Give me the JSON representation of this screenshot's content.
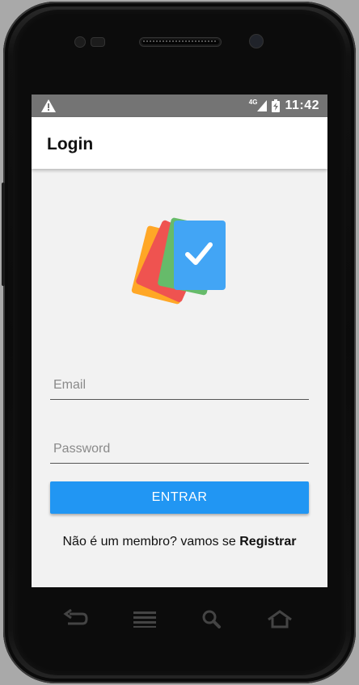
{
  "status_bar": {
    "warning_icon": "warning-triangle-icon",
    "network": "4G",
    "battery_icon": "battery-charging-icon",
    "time": "11:42"
  },
  "app_bar": {
    "title": "Login"
  },
  "logo": {
    "icon": "stacked-cards-check-icon",
    "colors": [
      "#ffa726",
      "#ef5350",
      "#66bb6a",
      "#42a5f5"
    ]
  },
  "form": {
    "email_placeholder": "Email",
    "email_value": "",
    "password_placeholder": "Password",
    "password_value": "",
    "submit_label": "ENTRAR"
  },
  "register": {
    "prompt": "Não é um membro? vamos se ",
    "link_label": "Registrar"
  },
  "nav_bar": {
    "back_icon": "back-icon",
    "menu_icon": "menu-icon",
    "search_icon": "search-icon",
    "home_icon": "home-icon"
  },
  "colors": {
    "accent": "#2196f3",
    "status_bar": "#747474",
    "background": "#f2f2f2"
  }
}
